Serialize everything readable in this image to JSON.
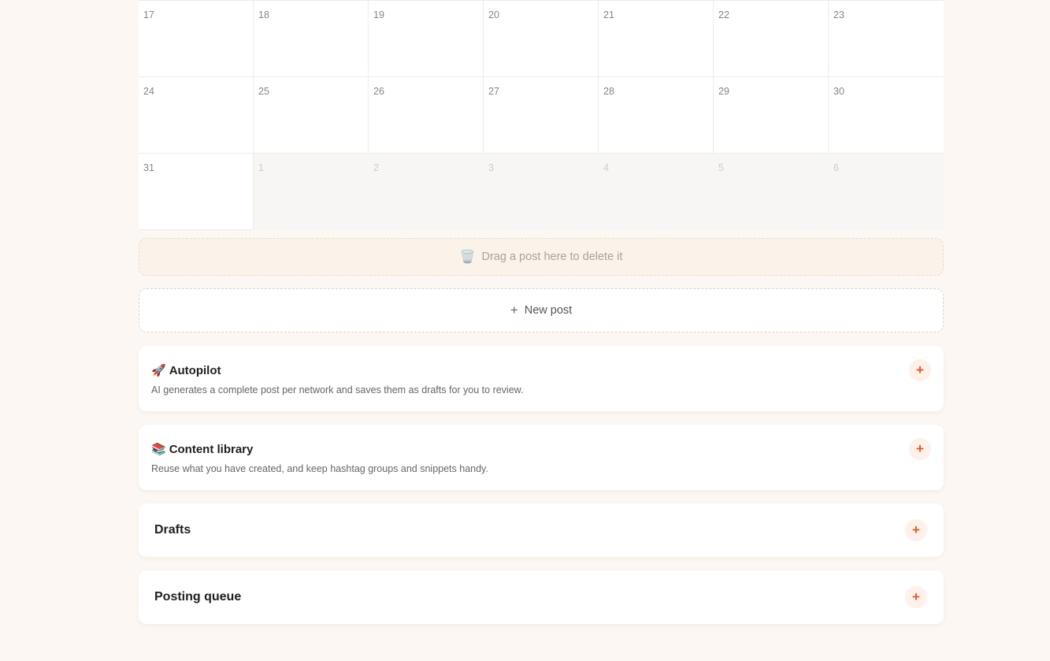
{
  "calendar": {
    "rows": [
      [
        {
          "d": "17"
        },
        {
          "d": "18"
        },
        {
          "d": "19"
        },
        {
          "d": "20"
        },
        {
          "d": "21"
        },
        {
          "d": "22"
        },
        {
          "d": "23"
        }
      ],
      [
        {
          "d": "24"
        },
        {
          "d": "25"
        },
        {
          "d": "26"
        },
        {
          "d": "27"
        },
        {
          "d": "28"
        },
        {
          "d": "29"
        },
        {
          "d": "30"
        }
      ],
      [
        {
          "d": "31"
        },
        {
          "d": "1",
          "other": true
        },
        {
          "d": "2",
          "other": true
        },
        {
          "d": "3",
          "other": true
        },
        {
          "d": "4",
          "other": true
        },
        {
          "d": "5",
          "other": true
        },
        {
          "d": "6",
          "other": true
        }
      ]
    ]
  },
  "trash": {
    "icon": "trash-icon",
    "glyph": "🗑️",
    "label": "Drag a post here to delete it"
  },
  "new_post": {
    "icon": "plus-icon",
    "glyph": "+",
    "label": "New post"
  },
  "autopilot": {
    "icon": "rocket-icon",
    "emoji": "🚀",
    "title": "Autopilot",
    "description": "AI generates a complete post per network and saves them as drafts for you to review."
  },
  "content_library": {
    "icon": "books-icon",
    "emoji": "📚",
    "title": "Content library",
    "description": "Reuse what you have created, and keep hashtag groups and snippets handy."
  },
  "drafts": {
    "title": "Drafts"
  },
  "posting_queue": {
    "title": "Posting queue"
  },
  "add_glyph": "+",
  "colors": {
    "accent": "#e5582a",
    "page_bg": "#fcf7f2",
    "other_month_bg": "#f8f6f4"
  }
}
